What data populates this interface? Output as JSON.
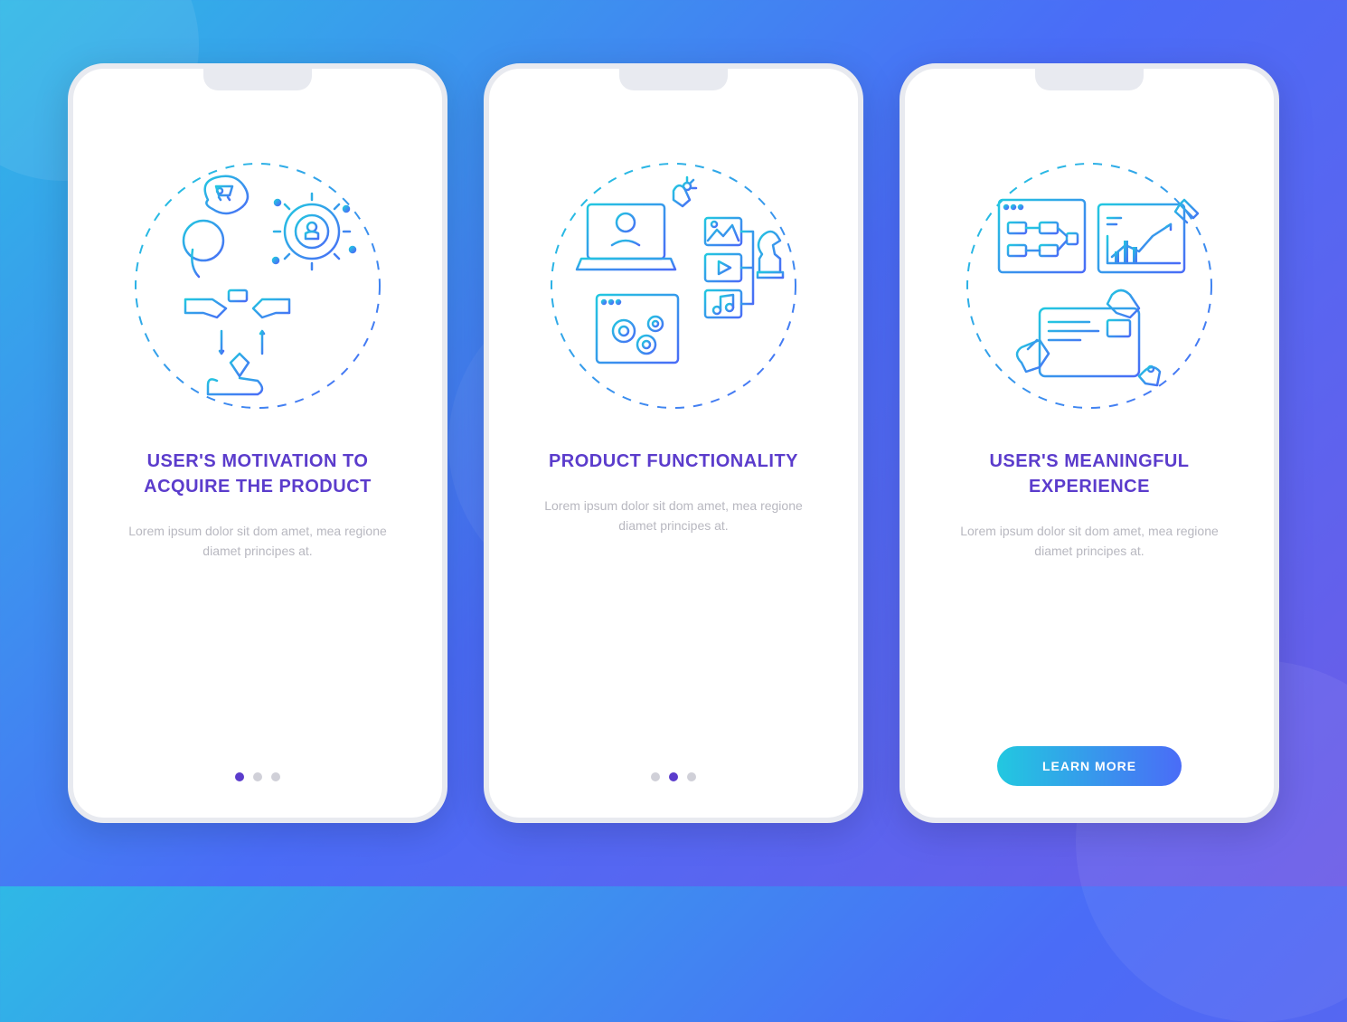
{
  "screens": [
    {
      "title": "USER'S MOTIVATION TO ACQUIRE THE PRODUCT",
      "body": "Lorem ipsum dolor sit dom amet, mea regione diamet principes at.",
      "icon": "motivation-illustration",
      "active_dot": 0
    },
    {
      "title": "PRODUCT FUNCTIONALITY",
      "body": "Lorem ipsum dolor sit dom amet, mea regione diamet principes at.",
      "icon": "functionality-illustration",
      "active_dot": 1
    },
    {
      "title": "USER'S MEANINGFUL EXPERIENCE",
      "body": "Lorem ipsum dolor sit dom amet, mea regione diamet principes at.",
      "icon": "experience-illustration",
      "cta_label": "LEARN MORE"
    }
  ],
  "colors": {
    "accent": "#5b3ccc",
    "gradient_start": "#22c8e0",
    "gradient_end": "#4a6cf7"
  }
}
